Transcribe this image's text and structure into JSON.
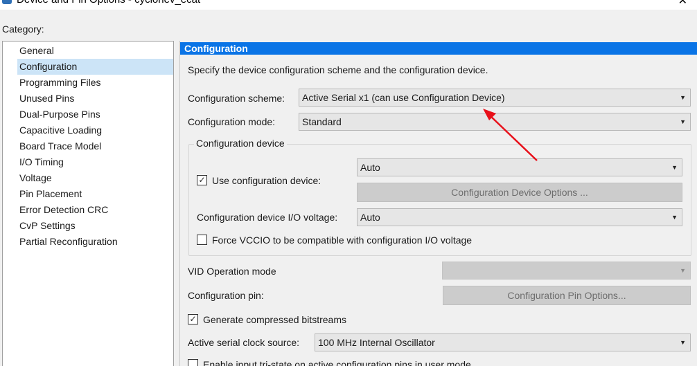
{
  "window": {
    "title": "Device and Pin Options - cyclonev_ecat",
    "close_glyph": "✕"
  },
  "category": {
    "label": "Category:",
    "items": [
      {
        "label": "General"
      },
      {
        "label": "Configuration",
        "selected": true
      },
      {
        "label": "Programming Files"
      },
      {
        "label": "Unused Pins"
      },
      {
        "label": "Dual-Purpose Pins"
      },
      {
        "label": "Capacitive Loading"
      },
      {
        "label": "Board Trace Model"
      },
      {
        "label": "I/O Timing"
      },
      {
        "label": "Voltage"
      },
      {
        "label": "Pin Placement"
      },
      {
        "label": "Error Detection CRC"
      },
      {
        "label": "CvP Settings"
      },
      {
        "label": "Partial Reconfiguration"
      }
    ]
  },
  "panel": {
    "header": "Configuration",
    "description": "Specify the device configuration scheme and the configuration device.",
    "scheme": {
      "label": "Configuration scheme:",
      "value": "Active Serial x1 (can use Configuration Device)"
    },
    "mode": {
      "label": "Configuration mode:",
      "value": "Standard"
    },
    "config_device": {
      "title": "Configuration device",
      "use_label": "Use configuration device:",
      "use_checked": true,
      "device_value": "Auto",
      "options_button": "Configuration Device Options ...",
      "io_voltage_label": "Configuration device I/O voltage:",
      "io_voltage_value": "Auto",
      "force_vccio_label": "Force VCCIO to be compatible with configuration I/O voltage",
      "force_vccio_checked": false
    },
    "vid": {
      "label": "VID Operation mode",
      "value": ""
    },
    "pin": {
      "label": "Configuration pin:",
      "button": "Configuration Pin Options..."
    },
    "compressed": {
      "label": "Generate compressed bitstreams",
      "checked": true
    },
    "clock": {
      "label": "Active serial clock source:",
      "value": "100 MHz Internal Oscillator"
    },
    "tristate": {
      "label": "Enable input tri-state on active configuration pins in user mode"
    }
  },
  "annotation": {
    "color": "#e8101a"
  },
  "icons": {
    "dropdown": "▼",
    "check": "✓"
  }
}
